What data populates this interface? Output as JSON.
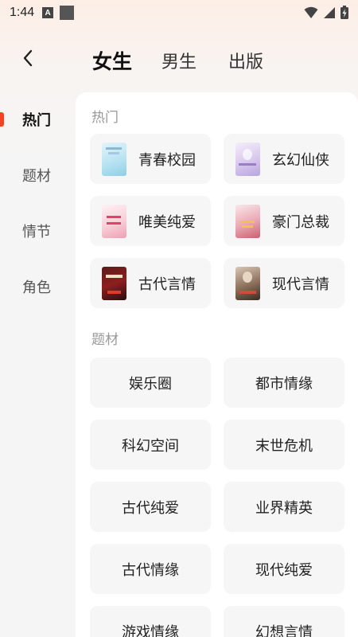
{
  "status": {
    "time": "1:44",
    "indicator_letter": "A"
  },
  "header": {
    "tabs": [
      "女生",
      "男生",
      "出版"
    ],
    "active_tab": 0
  },
  "sidebar": {
    "items": [
      "热门",
      "题材",
      "情节",
      "角色"
    ],
    "active": 0,
    "accent_color": "#f2441f"
  },
  "sections": {
    "hot": {
      "title": "热门",
      "items": [
        {
          "label": "青春校园",
          "cover": "light-blue-cover"
        },
        {
          "label": "玄幻仙侠",
          "cover": "lavender-cover"
        },
        {
          "label": "唯美纯爱",
          "cover": "pink-cover"
        },
        {
          "label": "豪门总裁",
          "cover": "rose-cover"
        },
        {
          "label": "古代言情",
          "cover": "dark-red-cover"
        },
        {
          "label": "现代言情",
          "cover": "sepia-cover"
        }
      ]
    },
    "topic": {
      "title": "题材",
      "items": [
        "娱乐圈",
        "都市情缘",
        "科幻空间",
        "末世危机",
        "古代纯爱",
        "业界精英",
        "古代情缘",
        "现代纯爱",
        "游戏情缘",
        "幻想言情"
      ]
    }
  }
}
